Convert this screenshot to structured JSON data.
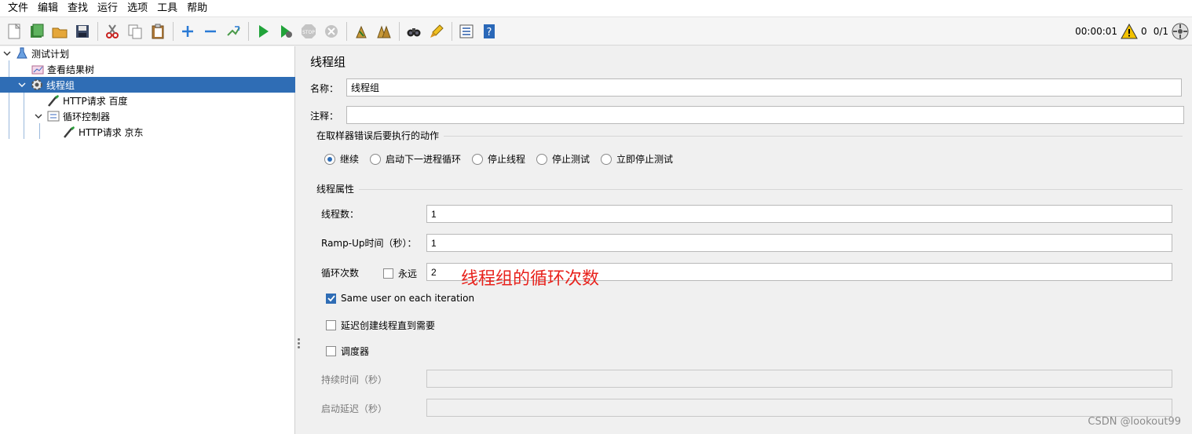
{
  "menu": [
    "文件",
    "编辑",
    "查找",
    "运行",
    "选项",
    "工具",
    "帮助"
  ],
  "toolbar": {
    "icons": [
      "new-icon",
      "templates-icon",
      "open-icon",
      "save-icon",
      "cut-icon",
      "copy-icon",
      "paste-icon",
      "expand-icon",
      "collapse-icon",
      "toggle-icon",
      "start-icon",
      "start-no-pause-icon",
      "stop-icon",
      "shutdown-icon",
      "clear-icon",
      "clear-all-icon",
      "search-icon",
      "reset-search-icon",
      "function-helper-icon",
      "help-icon"
    ],
    "timer": "00:00:01",
    "warnings": "0",
    "threads": "0/1"
  },
  "tree": {
    "items": [
      {
        "label": "测试计划",
        "icon": "test-plan-icon",
        "level": 0,
        "expanded": true
      },
      {
        "label": "查看结果树",
        "icon": "results-tree-icon",
        "level": 1
      },
      {
        "label": "线程组",
        "icon": "thread-group-icon",
        "level": 1,
        "expanded": true,
        "selected": true
      },
      {
        "label": "HTTP请求 百度",
        "icon": "http-sampler-icon",
        "level": 2
      },
      {
        "label": "循环控制器",
        "icon": "loop-controller-icon",
        "level": 2,
        "expanded": true
      },
      {
        "label": "HTTP请求 京东",
        "icon": "http-sampler-icon",
        "level": 3
      }
    ]
  },
  "panel": {
    "title": "线程组",
    "name_label": "名称：",
    "name_value": "线程组",
    "comment_label": "注释：",
    "comment_value": "",
    "error_section": "在取样器错误后要执行的动作",
    "error_options": [
      {
        "label": "继续",
        "selected": true
      },
      {
        "label": "启动下一进程循环",
        "selected": false
      },
      {
        "label": "停止线程",
        "selected": false
      },
      {
        "label": "停止测试",
        "selected": false
      },
      {
        "label": "立即停止测试",
        "selected": false
      }
    ],
    "props_section": "线程属性",
    "threads_label": "线程数：",
    "threads_value": "1",
    "rampup_label": "Ramp-Up时间（秒）：",
    "rampup_value": "1",
    "loop_label": "循环次数",
    "forever_label": "永远",
    "forever_checked": false,
    "loop_value": "2",
    "same_user_label": "Same user on each iteration",
    "same_user_checked": true,
    "delay_label": "延迟创建线程直到需要",
    "delay_checked": false,
    "scheduler_label": "调度器",
    "scheduler_checked": false,
    "duration_label": "持续时间（秒）",
    "duration_value": "",
    "startup_delay_label": "启动延迟（秒）",
    "startup_delay_value": ""
  },
  "annotation": "线程组的循环次数",
  "watermark": "CSDN @lookout99",
  "colors": {
    "selection": "#2f6db5",
    "annotation": "#e8221c",
    "warning": "#f2c200"
  }
}
